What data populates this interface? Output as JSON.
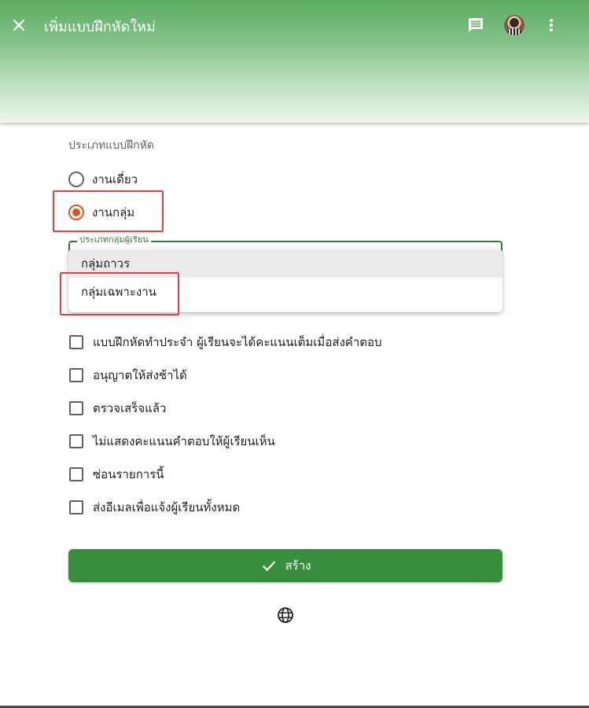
{
  "header": {
    "title": "เพิ่มแบบฝึกหัดใหม่",
    "icons": [
      "close-icon",
      "comment-icon",
      "avatar",
      "more-vert-icon"
    ]
  },
  "form": {
    "exercise_type_label": "ประเภทแบบฝึกหัด",
    "radio_options": [
      {
        "label": "งานเดี่ยว",
        "checked": false
      },
      {
        "label": "งานกลุ่ม",
        "checked": true
      }
    ],
    "group_select": {
      "legend": "ประเภทกลุ่มผู้เรียน",
      "options": [
        "กลุ่มถาวร",
        "กลุ่มเฉพาะงาน"
      ]
    },
    "checkboxes": [
      {
        "label": "แบบฝึกหัดทำประจำ ผู้เรียนจะได้คะแนนเต็มเมื่อส่งคำตอบ",
        "checked": false
      },
      {
        "label": "อนุญาตให้ส่งช้าได้",
        "checked": false
      },
      {
        "label": "ตรวจเสร็จแล้ว",
        "checked": false
      },
      {
        "label": "ไม่แสดงคะแนนคำตอบให้ผู้เรียนเห็น",
        "checked": false
      },
      {
        "label": "ซ่อนรายการนี้",
        "checked": false
      },
      {
        "label": "ส่งอีเมลเพื่อแจ้งผู้เรียนทั้งหมด",
        "checked": false
      }
    ],
    "create_button_label": "สร้าง"
  },
  "colors": {
    "header_green": "#5aab61",
    "radio_accent": "#d9541f",
    "button_green": "#388e3c",
    "highlight_red": "#e84040"
  }
}
